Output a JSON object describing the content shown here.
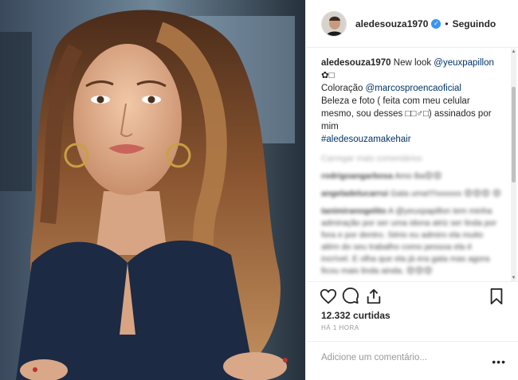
{
  "post": {
    "username": "aledesouza1970",
    "follow_state": "Seguindo",
    "separator": "•",
    "verified_mark": "✓"
  },
  "caption": {
    "username": "aledesouza1970",
    "line1_prefix": " New look ",
    "mention1": "@yeuxpapillon",
    "line2": "✿□",
    "line3_prefix": "Coloração ",
    "mention2": "@marcosproencaoficial",
    "line4": "Beleza e foto ( feita com meu celular mesmo, sou desses □□♂□) assinados por mim",
    "hashtag": "#aledesouzamakehair"
  },
  "load_more": "Carregar mais comentários",
  "comments": [
    {
      "username": "rodrigoangarbosa",
      "text": "Amo Ba😍😍"
    },
    {
      "username": "angeladelucarrui",
      "text": "Gata uma!!!!xxxxxx 😍😍😍 😍"
    },
    {
      "username": "tanimiranogelito",
      "text": "A @yeuxpapillon tem minha admiração por ser uma idona atriz ser linda por fora e por dentro. Sério eu admiro ela muito além do seu trabalho como pessoa ela é incrível. E olha que ela já era gata mas agora ficou mais linda ainda. 😍😍😍"
    }
  ],
  "actions": {
    "like_icon": "heart-icon",
    "comment_icon": "comment-icon",
    "share_icon": "share-icon",
    "save_icon": "bookmark-icon"
  },
  "likes": "12.332 curtidas",
  "time_ago": "Há 1 hora",
  "add_comment": {
    "placeholder": "Adicione um comentário..."
  },
  "more_label": "•••",
  "colors": {
    "link": "#003569",
    "verified": "#3897f0",
    "muted": "#999999",
    "border": "#efefef"
  }
}
